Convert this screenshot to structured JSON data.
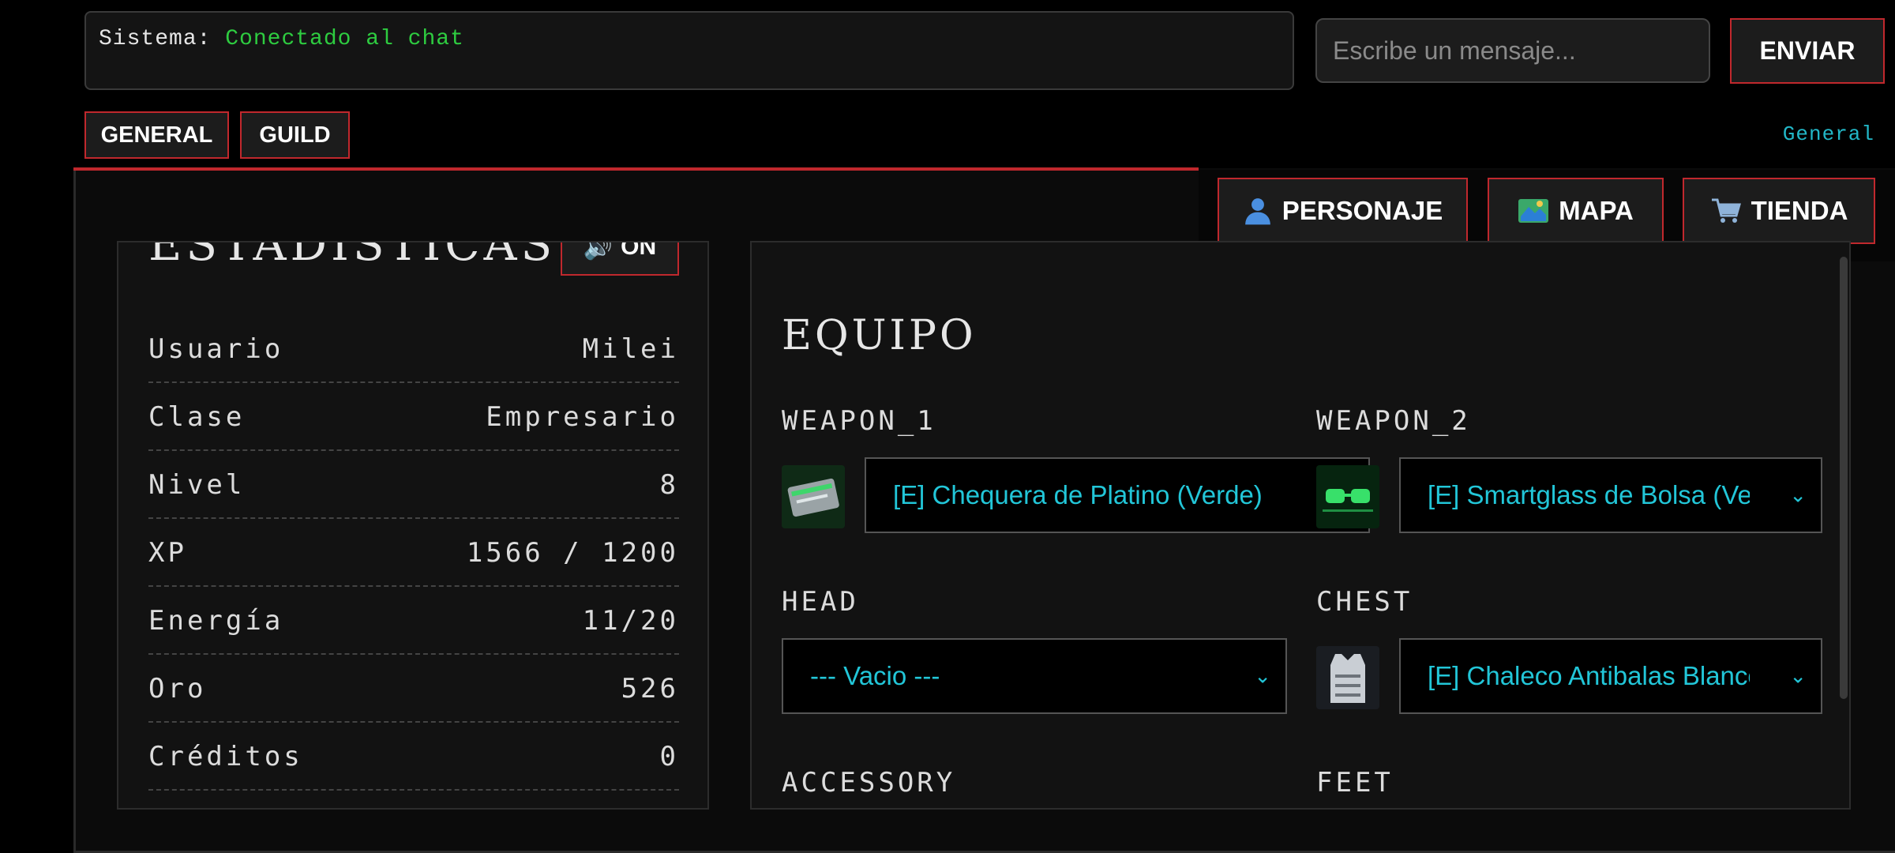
{
  "chat": {
    "system_prefix": "Sistema:",
    "system_message": "Conectado al chat",
    "input_placeholder": "Escribe un mensaje...",
    "send_label": "ENVIAR",
    "tabs": [
      "GENERAL",
      "GUILD"
    ],
    "active_channel": "General"
  },
  "nav": {
    "personaje": "PERSONAJE",
    "mapa": "MAPA",
    "tienda": "TIENDA"
  },
  "stats": {
    "title": "ESTADÍSTICAS",
    "sound_label": "ON",
    "rows": [
      {
        "label": "Usuario",
        "value": "Milei"
      },
      {
        "label": "Clase",
        "value": "Empresario"
      },
      {
        "label": "Nivel",
        "value": "8"
      },
      {
        "label": "XP",
        "value": "1566 / 1200"
      },
      {
        "label": "Energía",
        "value": "11/20"
      },
      {
        "label": "Oro",
        "value": "526"
      },
      {
        "label": "Créditos",
        "value": "0"
      }
    ]
  },
  "equipo": {
    "title": "EQUIPO",
    "slots": {
      "weapon_1": {
        "label": "WEAPON_1",
        "value": "[E] Chequera de Platino (Verde)"
      },
      "weapon_2": {
        "label": "WEAPON_2",
        "value": "[E] Smartglass de Bolsa (Verde)"
      },
      "head": {
        "label": "HEAD",
        "value": "--- Vacio ---"
      },
      "chest": {
        "label": "CHEST",
        "value": "[E] Chaleco Antibalas Blanco"
      },
      "accessory": {
        "label": "ACCESSORY"
      },
      "feet": {
        "label": "FEET"
      }
    }
  },
  "colors": {
    "accent_red": "#c0282d",
    "cyan": "#22c6d8",
    "system_green": "#2ecc40"
  }
}
